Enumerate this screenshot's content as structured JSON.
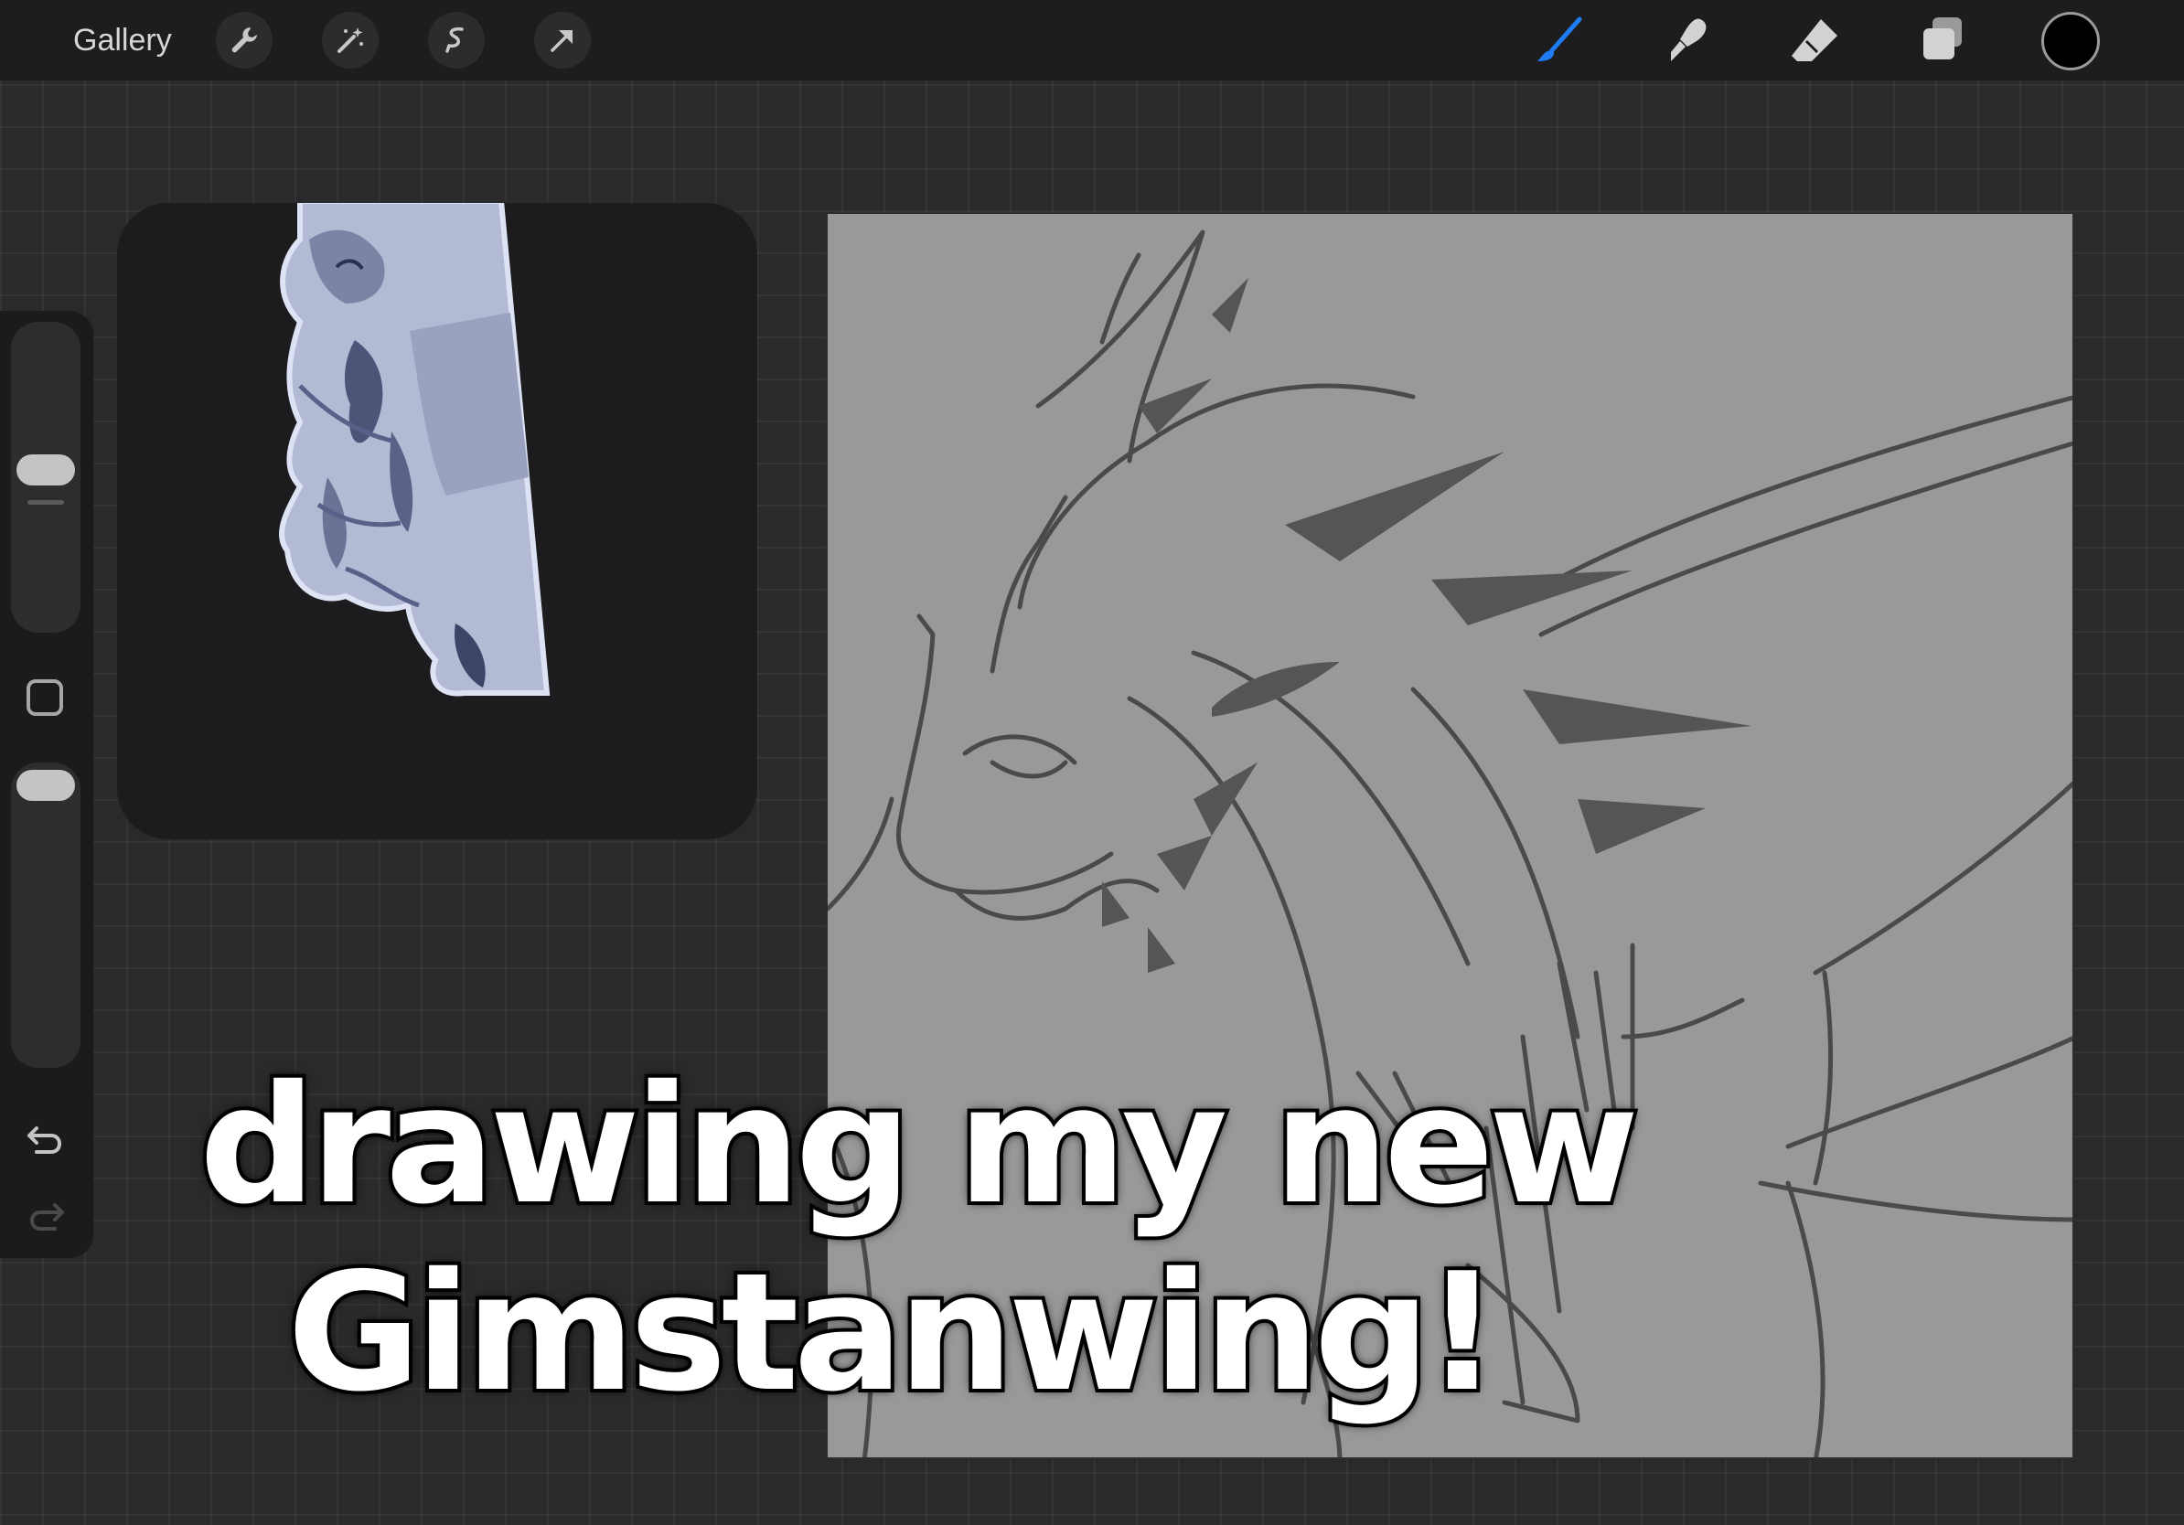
{
  "topbar": {
    "gallery_label": "Gallery",
    "left_tools": [
      "wrench-icon",
      "magic-wand-icon",
      "selection-icon",
      "transform-arrow-icon"
    ],
    "right_tools": [
      "brush-icon",
      "smudge-icon",
      "eraser-icon",
      "layers-icon"
    ],
    "active_tool": "brush-icon",
    "current_color": "#000000",
    "accent_color": "#1f7cf5"
  },
  "sidebar": {
    "brush_size_level": 0.5,
    "opacity_level": 1.0,
    "icons": [
      "modifier-square-icon",
      "undo-icon",
      "redo-icon"
    ]
  },
  "reference_window": {
    "content": "dragon reference image"
  },
  "caption": {
    "line1": "drawing my new",
    "line2": "Gimstanwing!"
  }
}
